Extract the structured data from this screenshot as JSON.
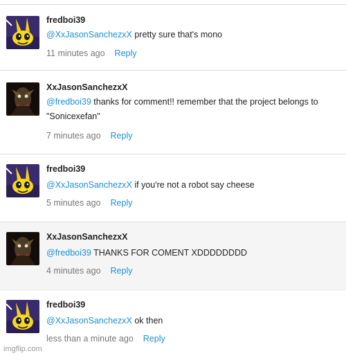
{
  "comments": [
    {
      "author": "fredboi39",
      "mention": "@XxJasonSanchezxX",
      "text": " pretty sure that's mono",
      "time": "11 minutes ago",
      "reply": "Reply",
      "avatar": "rabbit-avatar"
    },
    {
      "author": "XxJasonSanchezxX",
      "mention": "@fredboi39",
      "text": " thanks for comment!! remember that the project belongs to \"Sonicexefan\"",
      "time": "7 minutes ago",
      "reply": "Reply",
      "avatar": "monster-avatar"
    },
    {
      "author": "fredboi39",
      "mention": "@XxJasonSanchezxX",
      "text": " if you're not a robot say cheese",
      "time": "5 minutes ago",
      "reply": "Reply",
      "avatar": "rabbit-avatar"
    },
    {
      "author": "XxJasonSanchezxX",
      "mention": "@fredboi39",
      "text": " THANKS FOR COMENT XDDDDDDDD",
      "time": "4 minutes ago",
      "reply": "Reply",
      "avatar": "monster-avatar"
    },
    {
      "author": "fredboi39",
      "mention": "@XxJasonSanchezxX",
      "text": " ok then",
      "time": "less than a minute ago",
      "reply": "Reply",
      "avatar": "rabbit-avatar"
    }
  ],
  "footer": {
    "watermark": "imgflip.com"
  },
  "colors": {
    "link": "#1e90d6",
    "text": "#222222",
    "meta": "#777777",
    "alt_bg": "#f5f5f5"
  }
}
